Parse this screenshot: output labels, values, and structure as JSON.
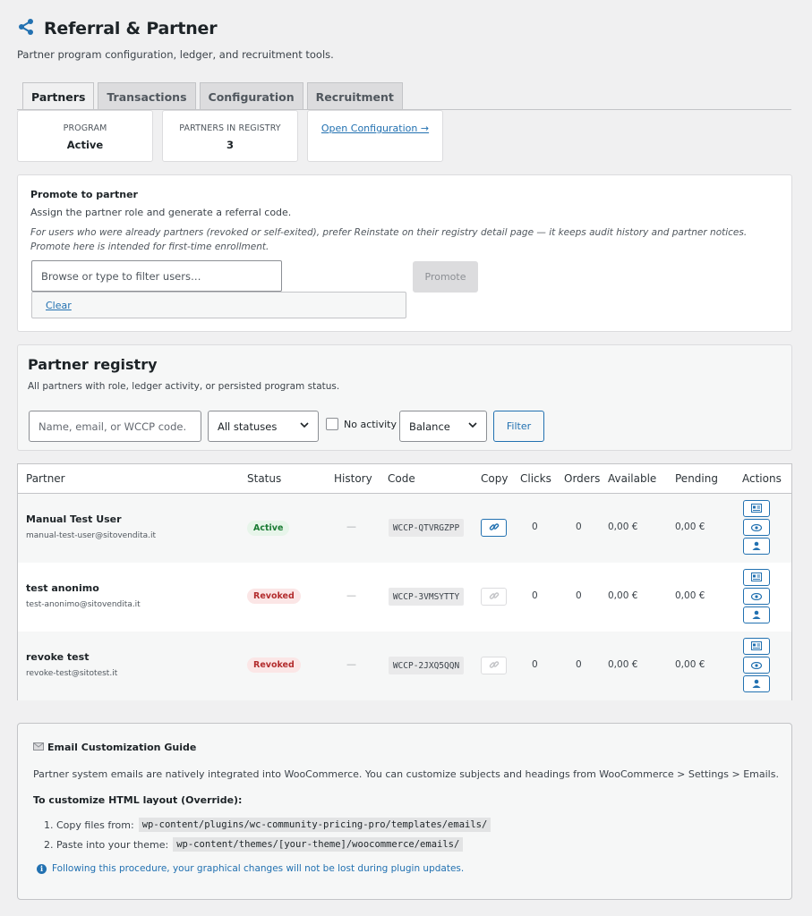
{
  "header": {
    "title": "Referral & Partner",
    "subtitle": "Partner program configuration, ledger, and recruitment tools.",
    "icon": "share-icon"
  },
  "tabs": [
    {
      "label": "Partners",
      "active": true
    },
    {
      "label": "Transactions",
      "active": false
    },
    {
      "label": "Configuration",
      "active": false
    },
    {
      "label": "Recruitment",
      "active": false
    }
  ],
  "stats": {
    "program_label": "PROGRAM",
    "program_value": "Active",
    "partners_label": "PARTNERS IN REGISTRY",
    "partners_value": "3",
    "config_link": "Open Configuration →"
  },
  "promote": {
    "heading": "Promote to partner",
    "description": "Assign the partner role and generate a referral code.",
    "note": "For users who were already partners (revoked or self-exited), prefer Reinstate on their registry detail page — it keeps audit history and partner notices. Promote here is intended for first-time enrollment.",
    "user_placeholder": "Browse or type to filter users…",
    "clear_label": "Clear",
    "promote_button": "Promote"
  },
  "registry": {
    "heading": "Partner registry",
    "description": "All partners with role, ledger activity, or persisted program status.",
    "search_placeholder": "Name, email, or WCCP code.",
    "status_select": "All statuses",
    "no_activity_label": "No activity",
    "sort_select": "Balance",
    "filter_button": "Filter"
  },
  "table": {
    "columns": [
      "Partner",
      "Status",
      "History",
      "Code",
      "Copy",
      "Clicks",
      "Orders",
      "Available",
      "Pending",
      "Actions"
    ],
    "rows": [
      {
        "name": "Manual Test User",
        "email": "manual-test-user@sitovendita.it",
        "status": "Active",
        "history": "—",
        "code": "WCCP-QTVRGZPP",
        "clicks": "0",
        "orders": "0",
        "available": "0,00 €",
        "pending": "0,00 €"
      },
      {
        "name": "test anonimo",
        "email": "test-anonimo@sitovendita.it",
        "status": "Revoked",
        "history": "—",
        "code": "WCCP-3VMSYTTY",
        "clicks": "0",
        "orders": "0",
        "available": "0,00 €",
        "pending": "0,00 €"
      },
      {
        "name": "revoke test",
        "email": "revoke-test@sitotest.it",
        "status": "Revoked",
        "history": "—",
        "code": "WCCP-2JXQ5QQN",
        "clicks": "0",
        "orders": "0",
        "available": "0,00 €",
        "pending": "0,00 €"
      }
    ]
  },
  "guide": {
    "heading": "Email Customization Guide",
    "paragraph": "Partner system emails are natively integrated into WooCommerce. You can customize subjects and headings from WooCommerce > Settings > Emails.",
    "override_heading": "To customize HTML layout (Override):",
    "step1_label": "1. Copy files from:",
    "step1_path": "wp-content/plugins/wc-community-pricing-pro/templates/emails/",
    "step2_label": "2. Paste into your theme:",
    "step2_path": "wp-content/themes/[your-theme]/woocommerce/emails/",
    "info": "Following this procedure, your graphical changes will not be lost during plugin updates."
  },
  "colors": {
    "accent": "#2271b1",
    "active": "#1a7b33",
    "revoked": "#b32d2e"
  }
}
